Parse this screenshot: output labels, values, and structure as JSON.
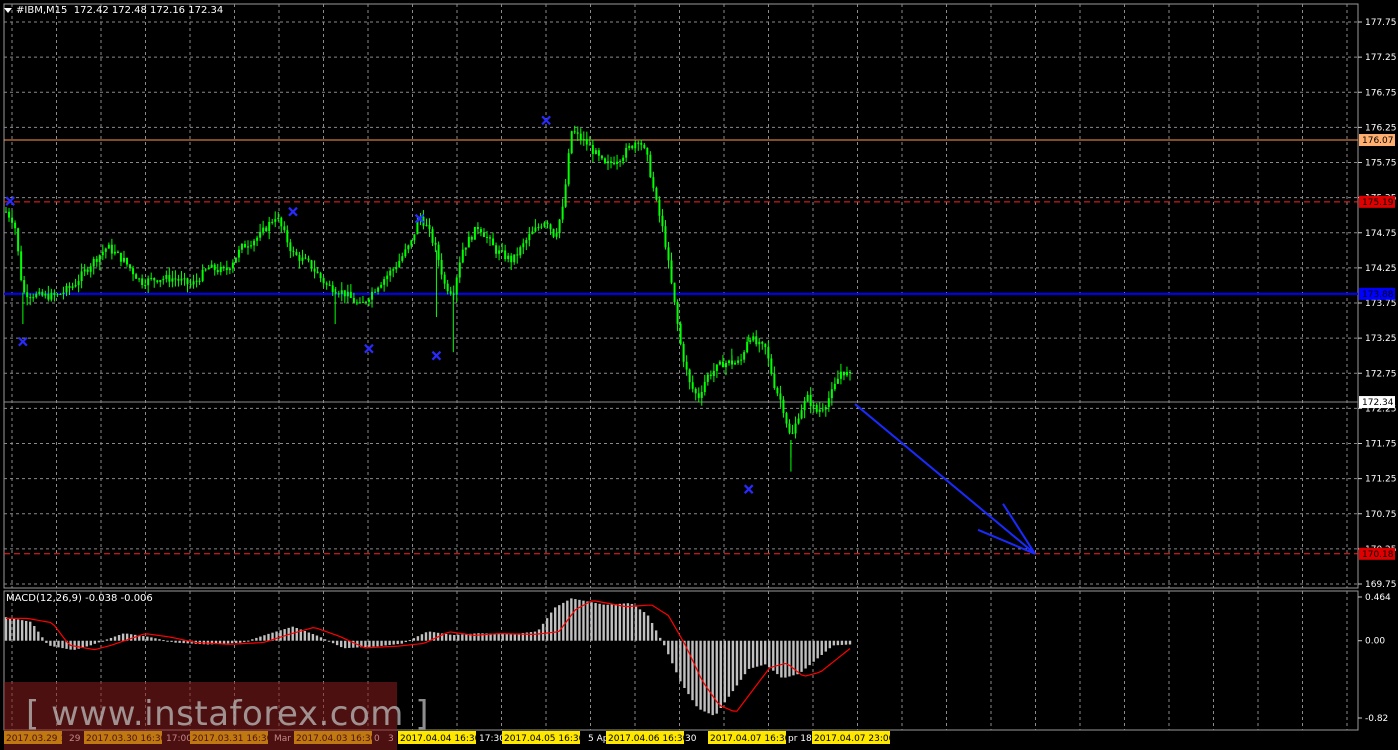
{
  "header": {
    "symbol": "#IBM,M15",
    "ohlc": "172.42 172.48 172.16 172.34"
  },
  "macd": {
    "label": "MACD(12,26,9) -0.038 -0.006",
    "axis_labels": [
      "0.464",
      "0.00",
      "-0.82"
    ]
  },
  "watermark": "[ www.instaforex.com ]",
  "colors": {
    "background": "#000000",
    "grid": "#8a8a8a",
    "candles": "#00ff00",
    "support_line": "#0000ff",
    "resistance_line": "#ff9a4d",
    "dashed_level": "#ff2020",
    "fractal": "#2a2aff",
    "arrow": "#1a2aff",
    "macd_hist": "#c0c0c0",
    "macd_signal": "#ff0000"
  },
  "chart_data": {
    "type": "candlestick",
    "symbol": "#IBM",
    "timeframe": "M15",
    "y_axis": {
      "ticks": [
        "177.75",
        "177.25",
        "176.75",
        "176.25",
        "175.75",
        "175.25",
        "174.75",
        "174.25",
        "173.75",
        "173.25",
        "172.75",
        "172.25",
        "171.75",
        "171.25",
        "170.75",
        "170.25",
        "169.75"
      ],
      "range": [
        169.6,
        178.0
      ]
    },
    "x_axis": {
      "ticks": [
        "2017.03.29 16:30",
        "29 M",
        "2017.03.30 16:30",
        "17:00",
        "2017.03.31 16:30",
        "Mar",
        "2017.04.03 16:30",
        "0",
        "3",
        "2017.04.04 16:30",
        "17:30",
        "2017.04.05 16:30",
        "5 Apr",
        "2017.04.06 16:30",
        "30",
        "2017.04.07 16:30",
        "pr 18:",
        "2017.04.07 23:00"
      ],
      "highlighted": [
        true,
        false,
        true,
        false,
        true,
        false,
        true,
        false,
        false,
        true,
        false,
        true,
        false,
        true,
        false,
        true,
        false,
        true
      ]
    },
    "levels": [
      {
        "label": "176.07",
        "value": 176.07,
        "style": "solid",
        "color": "#ff9a4d"
      },
      {
        "label": "175.19",
        "value": 175.19,
        "style": "dashed",
        "color": "#ff2020"
      },
      {
        "label": "173.88",
        "value": 173.88,
        "style": "solid",
        "color": "#0000ff"
      },
      {
        "label": "172.34",
        "value": 172.34,
        "style": "current",
        "color": "#8a8a8a"
      },
      {
        "label": "170.18",
        "value": 170.18,
        "style": "dashed",
        "color": "#ff2020"
      }
    ],
    "price_path": [
      [
        0,
        175.05
      ],
      [
        0.01,
        174.9
      ],
      [
        0.02,
        173.9
      ],
      [
        0.04,
        173.85
      ],
      [
        0.06,
        173.85
      ],
      [
        0.08,
        174.0
      ],
      [
        0.1,
        174.3
      ],
      [
        0.12,
        174.55
      ],
      [
        0.14,
        174.35
      ],
      [
        0.16,
        174.05
      ],
      [
        0.18,
        174.1
      ],
      [
        0.2,
        174.1
      ],
      [
        0.22,
        174.0
      ],
      [
        0.24,
        174.25
      ],
      [
        0.26,
        174.2
      ],
      [
        0.28,
        174.55
      ],
      [
        0.3,
        174.7
      ],
      [
        0.32,
        175.0
      ],
      [
        0.34,
        174.45
      ],
      [
        0.36,
        174.3
      ],
      [
        0.38,
        174.0
      ],
      [
        0.4,
        173.9
      ],
      [
        0.42,
        173.7
      ],
      [
        0.44,
        174.0
      ],
      [
        0.46,
        174.25
      ],
      [
        0.48,
        174.6
      ],
      [
        0.49,
        175.0
      ],
      [
        0.5,
        174.8
      ],
      [
        0.51,
        174.5
      ],
      [
        0.52,
        174.0
      ],
      [
        0.53,
        173.9
      ],
      [
        0.54,
        174.5
      ],
      [
        0.56,
        174.85
      ],
      [
        0.58,
        174.5
      ],
      [
        0.6,
        174.35
      ],
      [
        0.62,
        174.7
      ],
      [
        0.64,
        174.95
      ],
      [
        0.65,
        174.7
      ],
      [
        0.66,
        175.1
      ],
      [
        0.67,
        176.2
      ],
      [
        0.69,
        176.0
      ],
      [
        0.71,
        175.7
      ],
      [
        0.73,
        175.85
      ],
      [
        0.75,
        176.1
      ],
      [
        0.76,
        175.8
      ],
      [
        0.77,
        175.2
      ],
      [
        0.78,
        174.7
      ],
      [
        0.79,
        173.9
      ],
      [
        0.8,
        173.1
      ],
      [
        0.81,
        172.6
      ],
      [
        0.82,
        172.4
      ],
      [
        0.83,
        172.7
      ],
      [
        0.85,
        172.9
      ],
      [
        0.87,
        172.9
      ],
      [
        0.88,
        173.3
      ],
      [
        0.89,
        173.15
      ],
      [
        0.9,
        173.1
      ],
      [
        0.91,
        172.6
      ],
      [
        0.92,
        172.3
      ],
      [
        0.93,
        171.8
      ],
      [
        0.94,
        172.2
      ],
      [
        0.95,
        172.4
      ],
      [
        0.96,
        172.2
      ],
      [
        0.97,
        172.3
      ],
      [
        0.98,
        172.5
      ],
      [
        0.99,
        172.8
      ],
      [
        1.0,
        172.7
      ]
    ],
    "fractals": [
      {
        "type": "up",
        "value": 175.2
      },
      {
        "type": "down",
        "value": 173.2
      },
      {
        "type": "up",
        "value": 175.05
      },
      {
        "type": "down",
        "value": 173.1
      },
      {
        "type": "up",
        "value": 174.95
      },
      {
        "type": "down",
        "value": 173.0
      },
      {
        "type": "up",
        "value": 176.35
      },
      {
        "type": "down",
        "value": 171.1
      }
    ],
    "forecast_arrow": {
      "from": 172.34,
      "to": 170.18
    },
    "macd": {
      "params": "12,26,9",
      "main": -0.038,
      "signal": -0.006,
      "ylim": [
        -0.82,
        0.464
      ],
      "ticks": [
        0.464,
        0.0,
        -0.82
      ]
    }
  }
}
